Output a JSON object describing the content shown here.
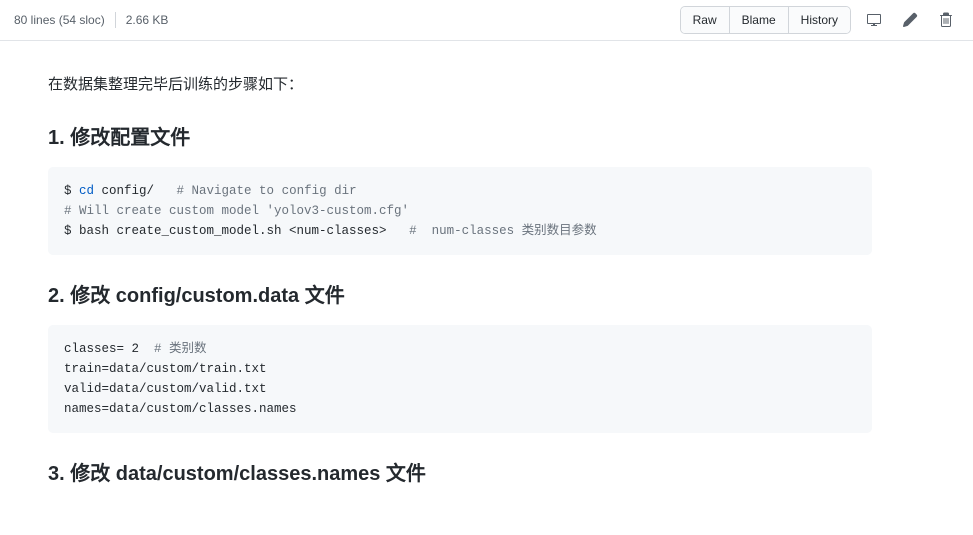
{
  "header": {
    "lines_text": "80 lines (54 sloc)",
    "size_text": "2.66 KB",
    "buttons": {
      "raw": "Raw",
      "blame": "Blame",
      "history": "History"
    }
  },
  "content": {
    "intro": "在数据集整理完毕后训练的步骤如下：",
    "sections": [
      {
        "heading": "1. 修改配置文件"
      },
      {
        "heading": "2. 修改 config/custom.data 文件"
      },
      {
        "heading": "3. 修改 data/custom/classes.names 文件"
      }
    ],
    "code1": {
      "l1a": "$ ",
      "l1b": "cd",
      "l1c": " config/   ",
      "l1d": "# Navigate to config dir",
      "l2": "# Will create custom model 'yolov3-custom.cfg'",
      "l3a": "$ bash create_custom_model.sh <num-classes>   ",
      "l3b": "#  num-classes 类别数目参数"
    },
    "code2": {
      "l1a": "classes= 2  ",
      "l1b": "# 类别数",
      "l2": "train=data/custom/train.txt",
      "l3": "valid=data/custom/valid.txt",
      "l4": "names=data/custom/classes.names"
    }
  }
}
